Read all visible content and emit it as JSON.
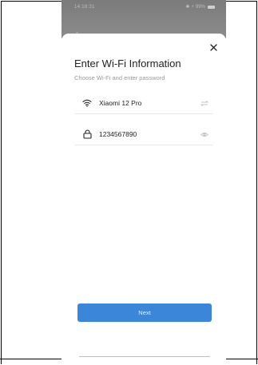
{
  "status_bar": {
    "time": "14:18:31",
    "indicators": "✱ ⚡ 99% "
  },
  "dialog": {
    "title": "Enter Wi-Fi Information",
    "subtitle": "Choose Wi-Fi and enter password",
    "wifi": {
      "value": "Xiaomi 12 Pro",
      "icon": "wifi-icon",
      "action_icon": "switch-icon"
    },
    "password": {
      "value": "1234567890",
      "icon": "lock-icon",
      "action_icon": "eye-icon"
    },
    "next_label": "Next",
    "close_icon": "close-icon"
  },
  "colors": {
    "accent": "#3b86d8",
    "status_bar": "#858585",
    "text_primary": "#222222",
    "text_secondary": "#9a9a9a"
  }
}
